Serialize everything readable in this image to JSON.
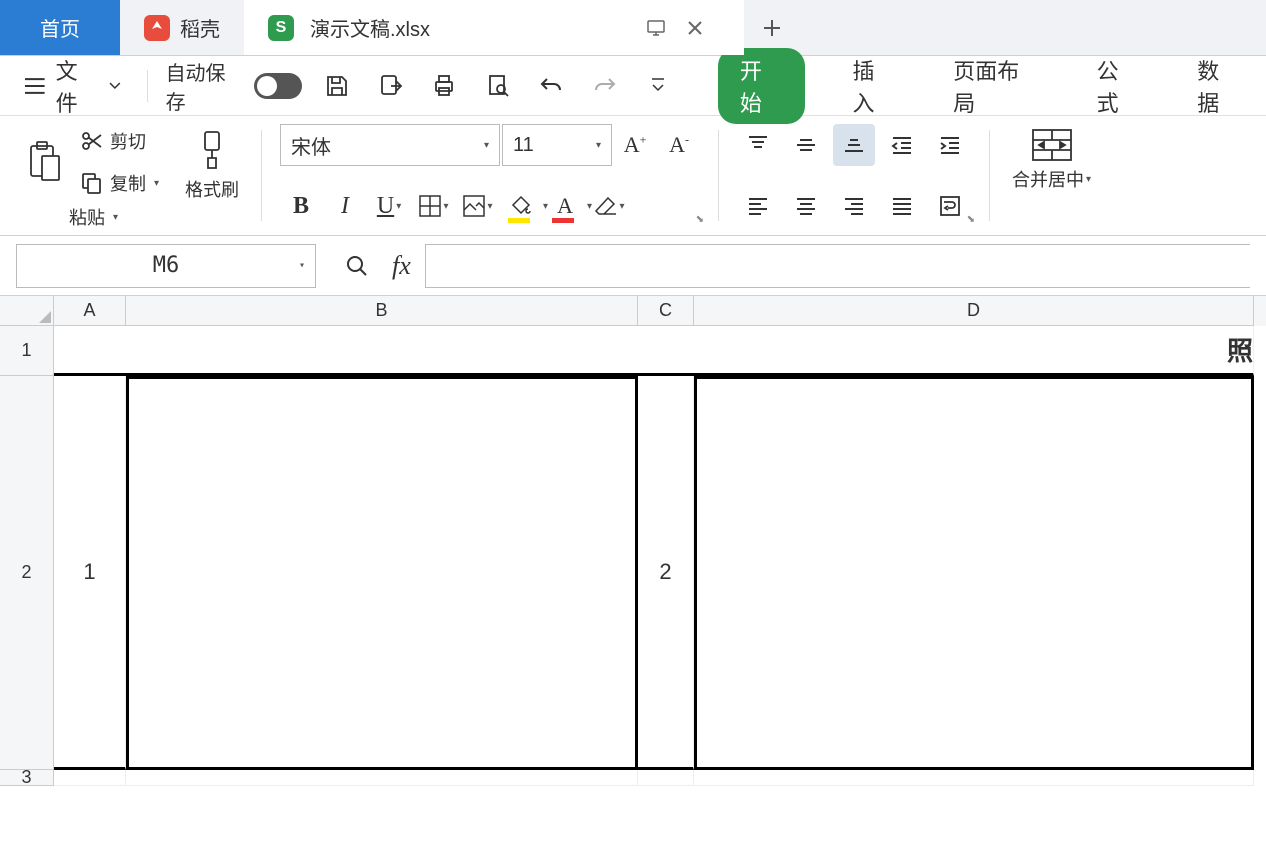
{
  "tabs": {
    "home": "首页",
    "docer": "稻壳",
    "file": "演示文稿.xlsx"
  },
  "qat": {
    "file_menu": "文件",
    "autosave": "自动保存"
  },
  "ribbon_tabs": {
    "start": "开始",
    "insert": "插入",
    "page_layout": "页面布局",
    "formula": "公式",
    "data": "数据"
  },
  "clipboard": {
    "paste": "粘贴",
    "cut": "剪切",
    "copy": "复制",
    "format_painter": "格式刷"
  },
  "font": {
    "name": "宋体",
    "size": "11"
  },
  "merge": "合并居中",
  "namebox": "M6",
  "columns": {
    "a": "A",
    "b": "B",
    "c": "C",
    "d": "D"
  },
  "rows": {
    "r1": "1",
    "r2": "2",
    "r3": "3"
  },
  "cells": {
    "title_partial": "照",
    "a2": "1",
    "c2": "2"
  }
}
